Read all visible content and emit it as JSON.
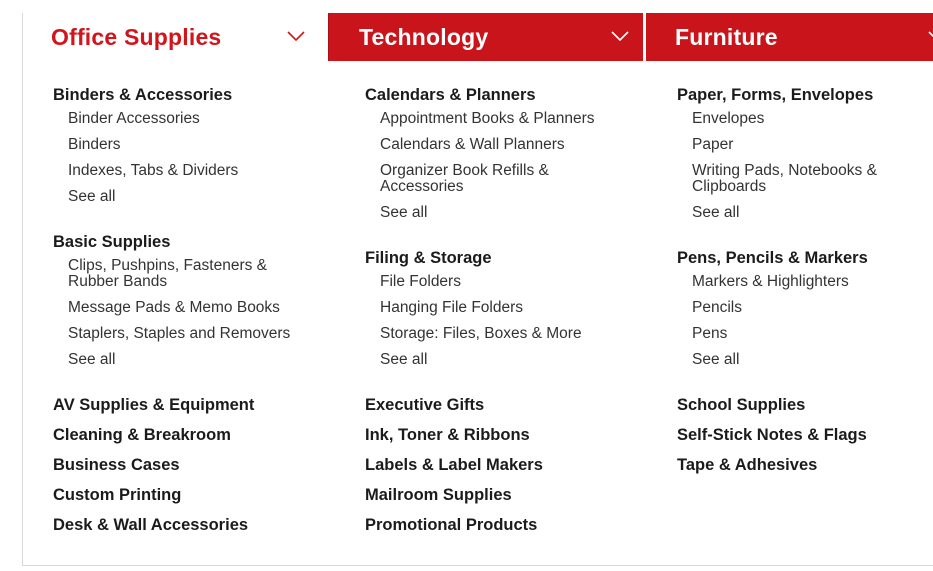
{
  "tabs": [
    {
      "label": "Office Supplies",
      "active": true
    },
    {
      "label": "Technology",
      "active": false
    },
    {
      "label": "Furniture",
      "active": false
    }
  ],
  "colors": {
    "accent_red": "#c8141a",
    "active_text": "#d3141b",
    "text": "#1b1b1b"
  },
  "columns": [
    {
      "groups": [
        {
          "title": "Binders & Accessories",
          "items": [
            "Binder Accessories",
            "Binders",
            "Indexes, Tabs & Dividers",
            "See all"
          ]
        },
        {
          "title": "Basic Supplies",
          "items": [
            "Clips, Pushpins, Fasteners & Rubber Bands",
            "Message Pads & Memo Books",
            "Staplers, Staples and Removers",
            "See all"
          ]
        }
      ],
      "links": [
        "AV Supplies & Equipment",
        "Cleaning & Breakroom",
        "Business Cases",
        "Custom Printing",
        "Desk & Wall Accessories"
      ]
    },
    {
      "groups": [
        {
          "title": "Calendars & Planners",
          "items": [
            "Appointment Books & Planners",
            "Calendars & Wall Planners",
            "Organizer Book Refills & Accessories",
            "See all"
          ]
        },
        {
          "title": "Filing & Storage",
          "items": [
            "File Folders",
            "Hanging File Folders",
            "Storage: Files, Boxes & More",
            "See all"
          ]
        }
      ],
      "links": [
        "Executive Gifts",
        "Ink, Toner & Ribbons",
        "Labels & Label Makers",
        "Mailroom Supplies",
        "Promotional Products"
      ]
    },
    {
      "groups": [
        {
          "title": "Paper, Forms, Envelopes",
          "items": [
            "Envelopes",
            "Paper",
            "Writing Pads, Notebooks & Clipboards",
            "See all"
          ]
        },
        {
          "title": "Pens, Pencils & Markers",
          "items": [
            "Markers & Highlighters",
            "Pencils",
            "Pens",
            "See all"
          ]
        }
      ],
      "links": [
        "School Supplies",
        "Self-Stick Notes & Flags",
        "Tape & Adhesives"
      ]
    }
  ]
}
